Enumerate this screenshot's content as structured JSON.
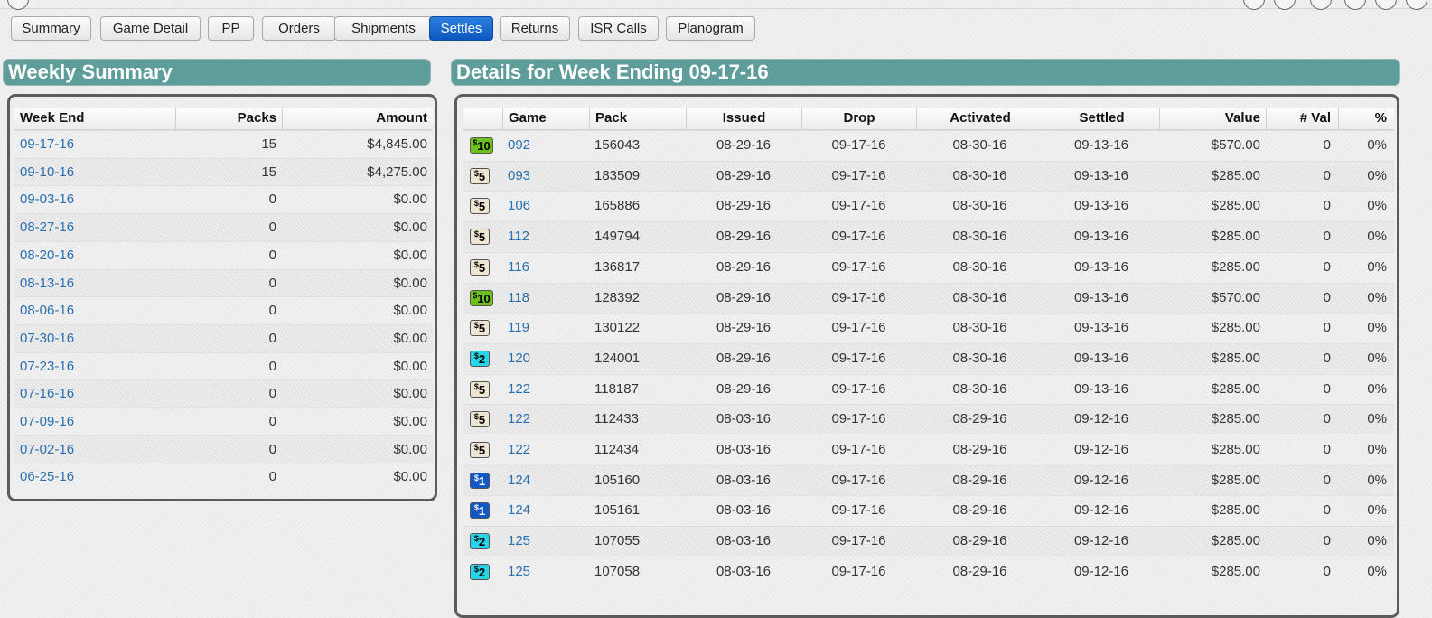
{
  "tabs": [
    {
      "label": "Summary",
      "active": false
    },
    {
      "label": "Game Detail",
      "active": false
    },
    {
      "label": "PP",
      "active": false
    },
    {
      "label": "Orders",
      "active": false
    },
    {
      "label": "Shipments",
      "active": false
    },
    {
      "label": "Settles",
      "active": true
    },
    {
      "label": "Returns",
      "active": false
    },
    {
      "label": "ISR Calls",
      "active": false
    },
    {
      "label": "Planogram",
      "active": false
    }
  ],
  "weekly_summary": {
    "title": "Weekly Summary",
    "columns": [
      "Week End",
      "Packs",
      "Amount"
    ],
    "rows": [
      [
        "09-17-16",
        "15",
        "$4,845.00"
      ],
      [
        "09-10-16",
        "15",
        "$4,275.00"
      ],
      [
        "09-03-16",
        "0",
        "$0.00"
      ],
      [
        "08-27-16",
        "0",
        "$0.00"
      ],
      [
        "08-20-16",
        "0",
        "$0.00"
      ],
      [
        "08-13-16",
        "0",
        "$0.00"
      ],
      [
        "08-06-16",
        "0",
        "$0.00"
      ],
      [
        "07-30-16",
        "0",
        "$0.00"
      ],
      [
        "07-23-16",
        "0",
        "$0.00"
      ],
      [
        "07-16-16",
        "0",
        "$0.00"
      ],
      [
        "07-09-16",
        "0",
        "$0.00"
      ],
      [
        "07-02-16",
        "0",
        "$0.00"
      ],
      [
        "06-25-16",
        "0",
        "$0.00"
      ]
    ]
  },
  "details": {
    "title": "Details for Week Ending 09-17-16",
    "columns": [
      "",
      "Game",
      "Pack",
      "Issued",
      "Drop",
      "Activated",
      "Settled",
      "Value",
      "# Val",
      "%"
    ],
    "badge_colors": {
      "$10": "#6cc21a",
      "$5": "#efe6d2",
      "$2": "#28d4e6",
      "$1": "#1158c7"
    },
    "badge_text_colors": {
      "$10": "#000000",
      "$5": "#000000",
      "$2": "#000000",
      "$1": "#ffffff"
    },
    "rows": [
      {
        "price": "$10",
        "game": "092",
        "pack": "156043",
        "issued": "08-29-16",
        "drop": "09-17-16",
        "activated": "08-30-16",
        "settled": "09-13-16",
        "value": "$570.00",
        "nval": "0",
        "pct": "0%"
      },
      {
        "price": "$5",
        "game": "093",
        "pack": "183509",
        "issued": "08-29-16",
        "drop": "09-17-16",
        "activated": "08-30-16",
        "settled": "09-13-16",
        "value": "$285.00",
        "nval": "0",
        "pct": "0%"
      },
      {
        "price": "$5",
        "game": "106",
        "pack": "165886",
        "issued": "08-29-16",
        "drop": "09-17-16",
        "activated": "08-30-16",
        "settled": "09-13-16",
        "value": "$285.00",
        "nval": "0",
        "pct": "0%"
      },
      {
        "price": "$5",
        "game": "112",
        "pack": "149794",
        "issued": "08-29-16",
        "drop": "09-17-16",
        "activated": "08-30-16",
        "settled": "09-13-16",
        "value": "$285.00",
        "nval": "0",
        "pct": "0%"
      },
      {
        "price": "$5",
        "game": "116",
        "pack": "136817",
        "issued": "08-29-16",
        "drop": "09-17-16",
        "activated": "08-30-16",
        "settled": "09-13-16",
        "value": "$285.00",
        "nval": "0",
        "pct": "0%"
      },
      {
        "price": "$10",
        "game": "118",
        "pack": "128392",
        "issued": "08-29-16",
        "drop": "09-17-16",
        "activated": "08-30-16",
        "settled": "09-13-16",
        "value": "$570.00",
        "nval": "0",
        "pct": "0%"
      },
      {
        "price": "$5",
        "game": "119",
        "pack": "130122",
        "issued": "08-29-16",
        "drop": "09-17-16",
        "activated": "08-30-16",
        "settled": "09-13-16",
        "value": "$285.00",
        "nval": "0",
        "pct": "0%"
      },
      {
        "price": "$2",
        "game": "120",
        "pack": "124001",
        "issued": "08-29-16",
        "drop": "09-17-16",
        "activated": "08-30-16",
        "settled": "09-13-16",
        "value": "$285.00",
        "nval": "0",
        "pct": "0%"
      },
      {
        "price": "$5",
        "game": "122",
        "pack": "118187",
        "issued": "08-29-16",
        "drop": "09-17-16",
        "activated": "08-30-16",
        "settled": "09-13-16",
        "value": "$285.00",
        "nval": "0",
        "pct": "0%"
      },
      {
        "price": "$5",
        "game": "122",
        "pack": "112433",
        "issued": "08-03-16",
        "drop": "09-17-16",
        "activated": "08-29-16",
        "settled": "09-12-16",
        "value": "$285.00",
        "nval": "0",
        "pct": "0%"
      },
      {
        "price": "$5",
        "game": "122",
        "pack": "112434",
        "issued": "08-03-16",
        "drop": "09-17-16",
        "activated": "08-29-16",
        "settled": "09-12-16",
        "value": "$285.00",
        "nval": "0",
        "pct": "0%"
      },
      {
        "price": "$1",
        "game": "124",
        "pack": "105160",
        "issued": "08-03-16",
        "drop": "09-17-16",
        "activated": "08-29-16",
        "settled": "09-12-16",
        "value": "$285.00",
        "nval": "0",
        "pct": "0%"
      },
      {
        "price": "$1",
        "game": "124",
        "pack": "105161",
        "issued": "08-03-16",
        "drop": "09-17-16",
        "activated": "08-29-16",
        "settled": "09-12-16",
        "value": "$285.00",
        "nval": "0",
        "pct": "0%"
      },
      {
        "price": "$2",
        "game": "125",
        "pack": "107055",
        "issued": "08-03-16",
        "drop": "09-17-16",
        "activated": "08-29-16",
        "settled": "09-12-16",
        "value": "$285.00",
        "nval": "0",
        "pct": "0%"
      },
      {
        "price": "$2",
        "game": "125",
        "pack": "107058",
        "issued": "08-03-16",
        "drop": "09-17-16",
        "activated": "08-29-16",
        "settled": "09-12-16",
        "value": "$285.00",
        "nval": "0",
        "pct": "0%"
      }
    ]
  }
}
